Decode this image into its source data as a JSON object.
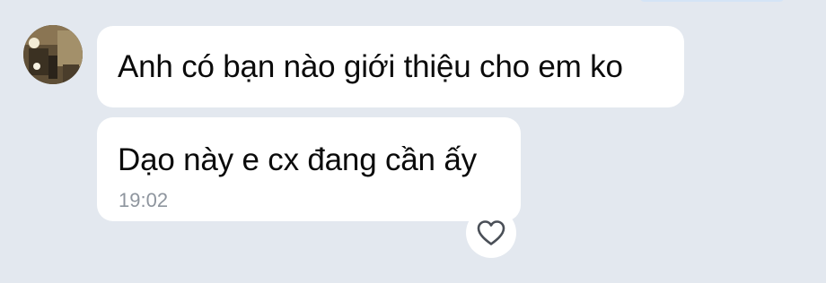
{
  "chat": {
    "messages": [
      {
        "text": "Anh có bạn nào giới thiệu cho em ko"
      },
      {
        "text": "Dạo này e cx đang cần ấy",
        "time": "19:02"
      }
    ],
    "sender": {
      "avatar": "avatar-photo-icon"
    },
    "reaction": {
      "icon": "heart-outline-icon"
    }
  },
  "colors": {
    "background": "#e3e8ef",
    "bubble": "#ffffff",
    "text": "#0b0b0b",
    "timestamp": "#8e959e",
    "outgoing_bubble_edge": "#d4e4f6"
  }
}
